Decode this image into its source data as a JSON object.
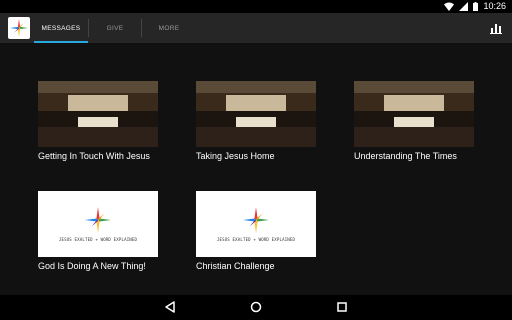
{
  "status_bar": {
    "time": "10:26"
  },
  "tabs": [
    {
      "label": "MESSAGES",
      "active": true
    },
    {
      "label": "GIVE",
      "active": false
    },
    {
      "label": "MORE",
      "active": false
    }
  ],
  "icons": {
    "logo": "church-star-logo",
    "chart": "bar-chart-icon",
    "back": "back-icon",
    "home": "home-icon",
    "recents": "recents-icon"
  },
  "colors": {
    "accent": "#2aa8e0",
    "app_bar": "#262626",
    "background": "#111111"
  },
  "messages": [
    {
      "title": "Getting In Touch With Jesus",
      "thumbnail": "congregation-photo"
    },
    {
      "title": "Taking Jesus Home",
      "thumbnail": "congregation-photo"
    },
    {
      "title": "Understanding The Times",
      "thumbnail": "congregation-photo"
    },
    {
      "title": "God Is Doing  A New Thing!",
      "thumbnail": "logo-graphic",
      "tagline": "JESUS EXALTED + WORD EXPLAINED"
    },
    {
      "title": "Christian Challenge",
      "thumbnail": "logo-graphic",
      "tagline": "JESUS EXALTED + WORD EXPLAINED"
    }
  ]
}
